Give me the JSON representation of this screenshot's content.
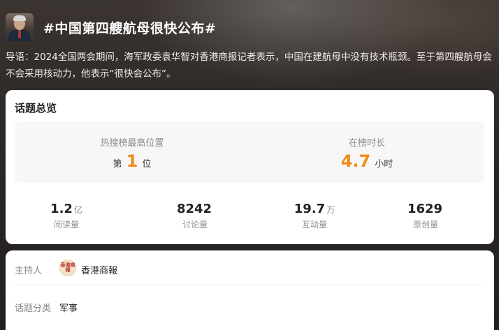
{
  "topic": {
    "title": "#中国第四艘航母很快公布#",
    "intro": "导语：2024全国两会期间，海军政委袁华智对香港商报记者表示，中国在建航母中没有技术瓶颈。至于第四艘航母会不会采用核动力，他表示“很快会公布”。"
  },
  "overview": {
    "title": "话题总览",
    "hot_rank": {
      "label": "热搜榜最高位置",
      "prefix": "第",
      "value": "1",
      "suffix": "位"
    },
    "duration": {
      "label": "在榜时长",
      "value": "4.7",
      "unit": "小时"
    },
    "stats": [
      {
        "num": "1.2",
        "unit": "亿",
        "label": "阅读量"
      },
      {
        "num": "8242",
        "unit": "",
        "label": "讨论量"
      },
      {
        "num": "19.7",
        "unit": "万",
        "label": "互动量"
      },
      {
        "num": "1629",
        "unit": "",
        "label": "原创量"
      }
    ]
  },
  "info": {
    "host_label": "主持人",
    "host_name": "香港商報",
    "host_logo_text": "香港商報",
    "category_label": "话题分类",
    "category_value": "军事"
  },
  "colors": {
    "accent_orange": "#f38a1c",
    "card_bg": "#ffffff",
    "header_bg": "#2d2826"
  }
}
